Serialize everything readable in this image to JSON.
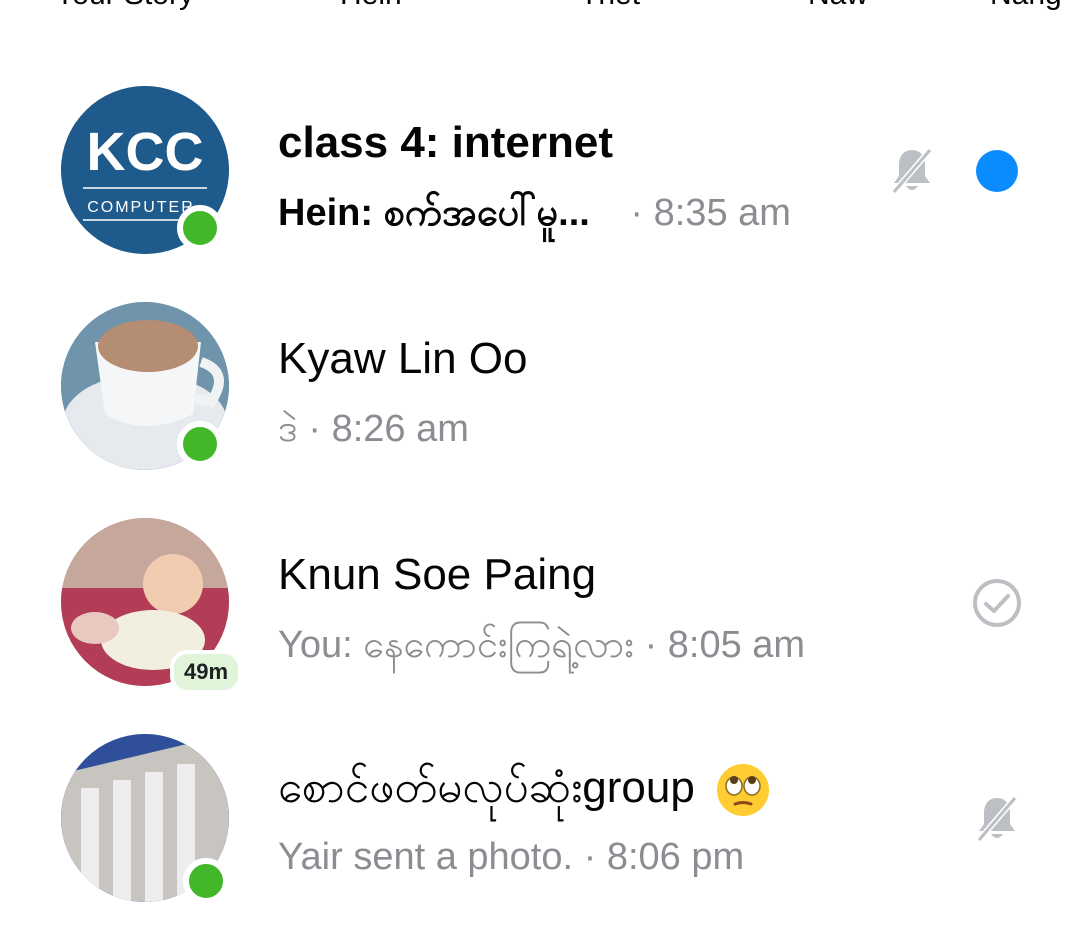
{
  "stories": [
    "Your Story",
    "Hein",
    "Thet",
    "Naw",
    "Nang"
  ],
  "chats": [
    {
      "name": "class 4: internet",
      "preview": "Hein: စက်အပေါ်မူ...",
      "time": "· 8:35 am",
      "unread": true,
      "muted": true,
      "avatar_text": "KCC",
      "avatar_subtext": "COMPUTER"
    },
    {
      "name": "Kyaw Lin Oo",
      "preview": "ဒဲ",
      "time": "· 8:26 am",
      "unread": false,
      "muted": false
    },
    {
      "name": "Knun Soe Paing",
      "preview": "You: နေကောင်းကြရဲ့လား",
      "time": "· 8:05 am",
      "unread": false,
      "muted": false,
      "active_badge": "49m",
      "status_icon": "seen-check-icon"
    },
    {
      "name": "စောင်ဖတ်မလုပ်ဆုံးgroup",
      "emoji": "eye-roll-emoji-icon",
      "preview": "Yair sent a photo.",
      "time": "· 8:06 pm",
      "unread": false,
      "muted": true
    }
  ],
  "colors": {
    "online": "#42b72a",
    "unread": "#0a8cff",
    "muted_icon": "#bcc0c4",
    "secondary_text": "#8a8d91"
  }
}
